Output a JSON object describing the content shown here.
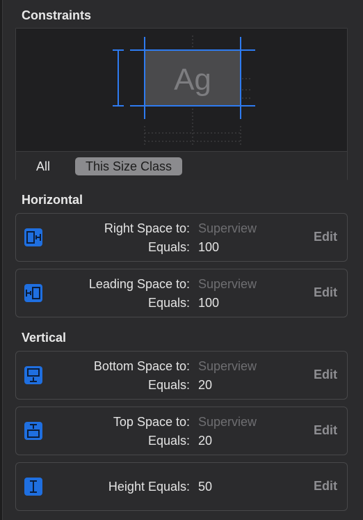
{
  "panel": {
    "title": "Constraints",
    "preview_sample_text": "Ag",
    "tabs": [
      {
        "label": "All",
        "selected": false
      },
      {
        "label": "This Size Class",
        "selected": true
      }
    ]
  },
  "horizontal": {
    "title": "Horizontal",
    "constraints": [
      {
        "icon": "right-space-icon",
        "label": "Right Space to:",
        "target": "Superview",
        "equals_label": "Equals:",
        "value": "100",
        "edit": "Edit"
      },
      {
        "icon": "leading-space-icon",
        "label": "Leading Space to:",
        "target": "Superview",
        "equals_label": "Equals:",
        "value": "100",
        "edit": "Edit"
      }
    ]
  },
  "vertical": {
    "title": "Vertical",
    "constraints": [
      {
        "icon": "bottom-space-icon",
        "label": "Bottom Space to:",
        "target": "Superview",
        "equals_label": "Equals:",
        "value": "20",
        "edit": "Edit"
      },
      {
        "icon": "top-space-icon",
        "label": "Top Space to:",
        "target": "Superview",
        "equals_label": "Equals:",
        "value": "20",
        "edit": "Edit"
      },
      {
        "icon": "height-icon",
        "label": "Height Equals:",
        "value": "50",
        "edit": "Edit"
      }
    ]
  },
  "colors": {
    "accent": "#1f6fe0",
    "guide_blue": "#2e7bf0",
    "background": "#2b2b2d"
  }
}
